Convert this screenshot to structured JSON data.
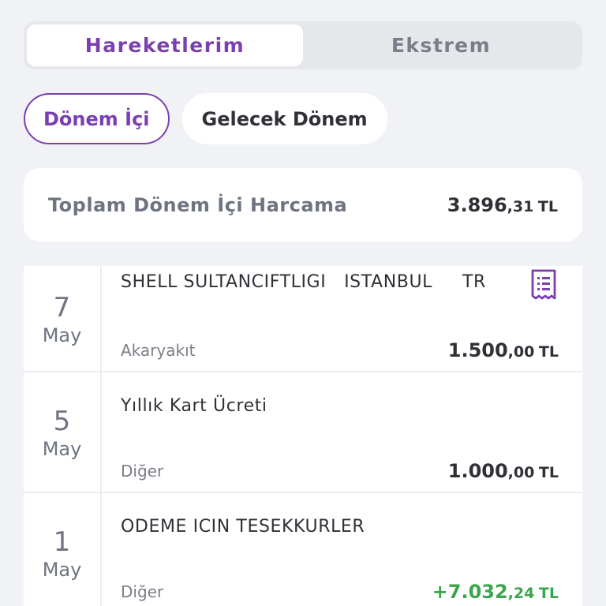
{
  "tabs": [
    {
      "label": "Hareketlerim",
      "active": true
    },
    {
      "label": "Ekstrem",
      "active": false
    }
  ],
  "period_filters": [
    {
      "label": "Dönem İçi",
      "active": true
    },
    {
      "label": "Gelecek Dönem",
      "active": false
    }
  ],
  "summary": {
    "label": "Toplam Dönem İçi Harcama",
    "amount_main": "3.896",
    "amount_decimals": ",31",
    "currency": "TL"
  },
  "transactions": [
    {
      "day": "7",
      "month": "May",
      "merchant": "SHELL SULTANCIFTLIGI   ISTANBUL     TR",
      "category": "Akaryakıt",
      "amount_main": "1.500",
      "amount_decimals": ",00",
      "currency": "TL",
      "has_receipt": true,
      "receipt_icon": "receipt-icon"
    },
    {
      "day": "5",
      "month": "May",
      "merchant": "Yıllık Kart Ücreti",
      "category": "Diğer",
      "amount_main": "1.000",
      "amount_decimals": ",00",
      "currency": "TL",
      "has_receipt": false
    },
    {
      "day": "1",
      "month": "May",
      "merchant": "ODEME ICIN TESEKKURLER",
      "category": "Diğer",
      "amount_main": "+7.032",
      "amount_decimals": ",24",
      "currency": "TL",
      "has_receipt": false,
      "positive": true
    }
  ],
  "colors": {
    "accent": "#7b3fb2",
    "background": "#f1f2f6",
    "positive": "#3aa64b",
    "text_muted": "#6e7480"
  }
}
